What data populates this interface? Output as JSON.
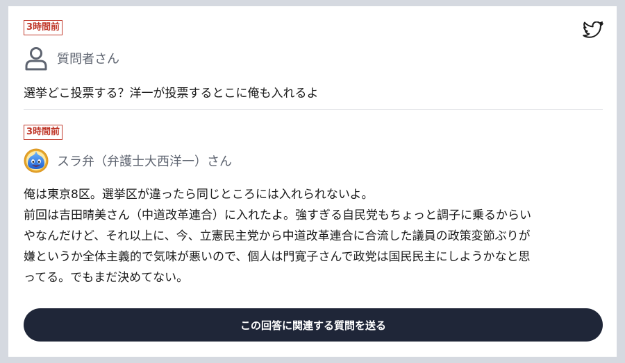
{
  "question": {
    "time": "3時間前",
    "user_name": "質問者さん",
    "text": "選挙どこ投票する？洋一が投票するとこに俺も入れるよ"
  },
  "answer": {
    "time": "3時間前",
    "user_name": "スラ弁（弁護士大西洋一）さん",
    "lines": [
      "俺は東京8区。選挙区が違ったら同じところには入れられないよ。",
      "前回は吉田晴美さん（中道改革連合）に入れたよ。強すぎる自民党もちょっと調子に乗るからい",
      "やなんだけど、それ以上に、今、立憲民主党から中道改革連合に合流した議員の政策変節ぶりが",
      "嫌というか全体主義的で気味が悪いので、個人は門寛子さんで政党は国民民主にしようかなと思",
      "ってる。でもまだ決めてない。"
    ]
  },
  "cta": {
    "label": "この回答に関連する質問を送る"
  },
  "icons": {
    "share": "twitter-icon",
    "question_avatar": "user-icon",
    "answer_avatar": "slime-avatar"
  },
  "colors": {
    "time_badge": "#c0392b",
    "cta_background": "#1f2638",
    "page_background": "#d5d9e0"
  }
}
